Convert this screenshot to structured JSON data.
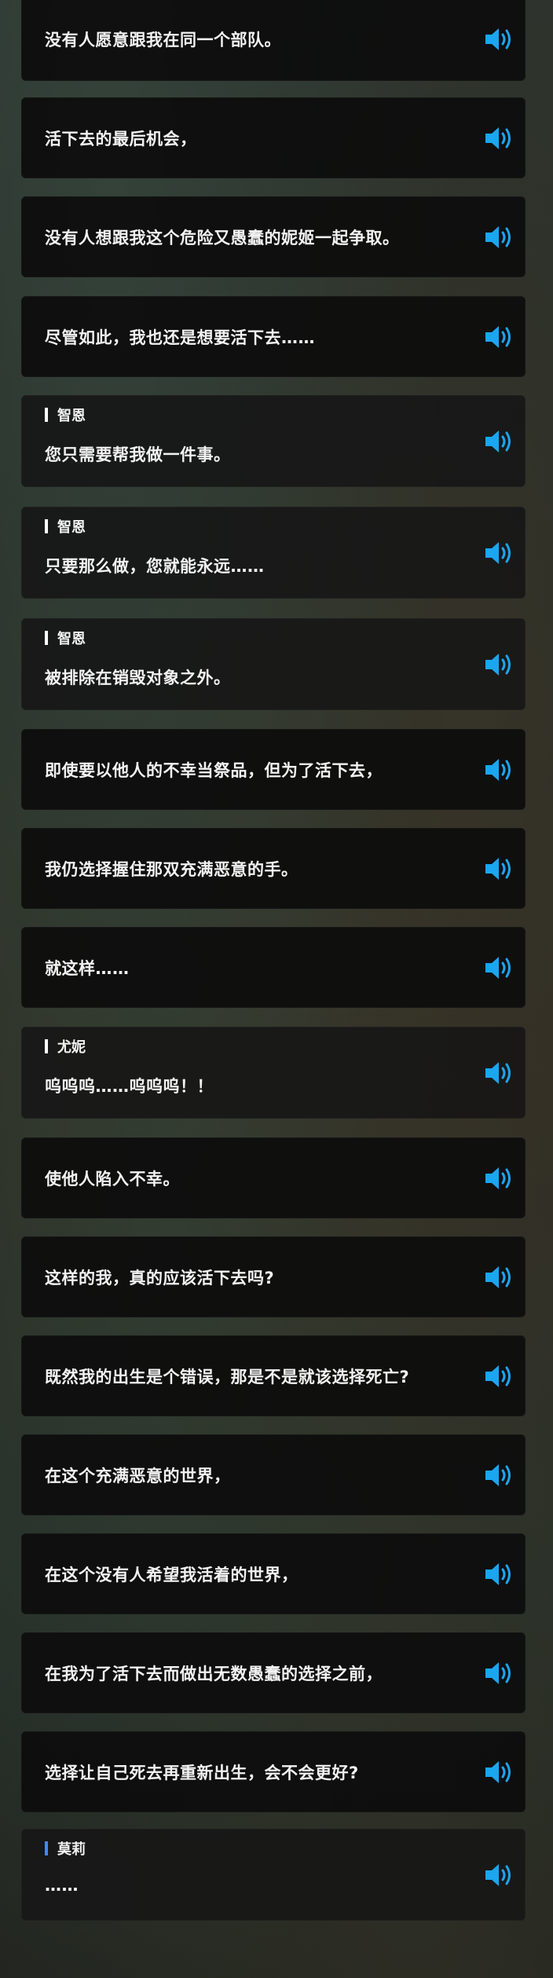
{
  "dialogues": [
    {
      "speaker": "",
      "text": "没有人愿意跟我在同一个部队。"
    },
    {
      "speaker": "",
      "text": "活下去的最后机会，"
    },
    {
      "speaker": "",
      "text": "没有人想跟我这个危险又愚蠢的妮姬一起争取。"
    },
    {
      "speaker": "",
      "text": "尽管如此，我也还是想要活下去……"
    },
    {
      "speaker": "智恩",
      "text": "您只需要帮我做一件事。"
    },
    {
      "speaker": "智恩",
      "text": "只要那么做，您就能永远……"
    },
    {
      "speaker": "智恩",
      "text": "被排除在销毁对象之外。"
    },
    {
      "speaker": "",
      "text": "即使要以他人的不幸当祭品，但为了活下去，"
    },
    {
      "speaker": "",
      "text": "我仍选择握住那双充满恶意的手。"
    },
    {
      "speaker": "",
      "text": "就这样……"
    },
    {
      "speaker": "尤妮",
      "text": "呜呜呜……呜呜呜！！"
    },
    {
      "speaker": "",
      "text": "使他人陷入不幸。"
    },
    {
      "speaker": "",
      "text": "这样的我，真的应该活下去吗?"
    },
    {
      "speaker": "",
      "text": "既然我的出生是个错误，那是不是就该选择死亡?"
    },
    {
      "speaker": "",
      "text": "在这个充满恶意的世界，"
    },
    {
      "speaker": "",
      "text": "在这个没有人希望我活着的世界，"
    },
    {
      "speaker": "",
      "text": "在我为了活下去而做出无数愚蠢的选择之前，"
    },
    {
      "speaker": "",
      "text": "选择让自己死去再重新出生，会不会更好?"
    },
    {
      "speaker": "莫莉",
      "text": "……",
      "accent": "#3d8bff"
    }
  ],
  "icon": "speaker-volume-icon",
  "colors": {
    "icon": "#1aa6f0",
    "text": "#f2f2f2",
    "card": "#0d0d0d"
  }
}
